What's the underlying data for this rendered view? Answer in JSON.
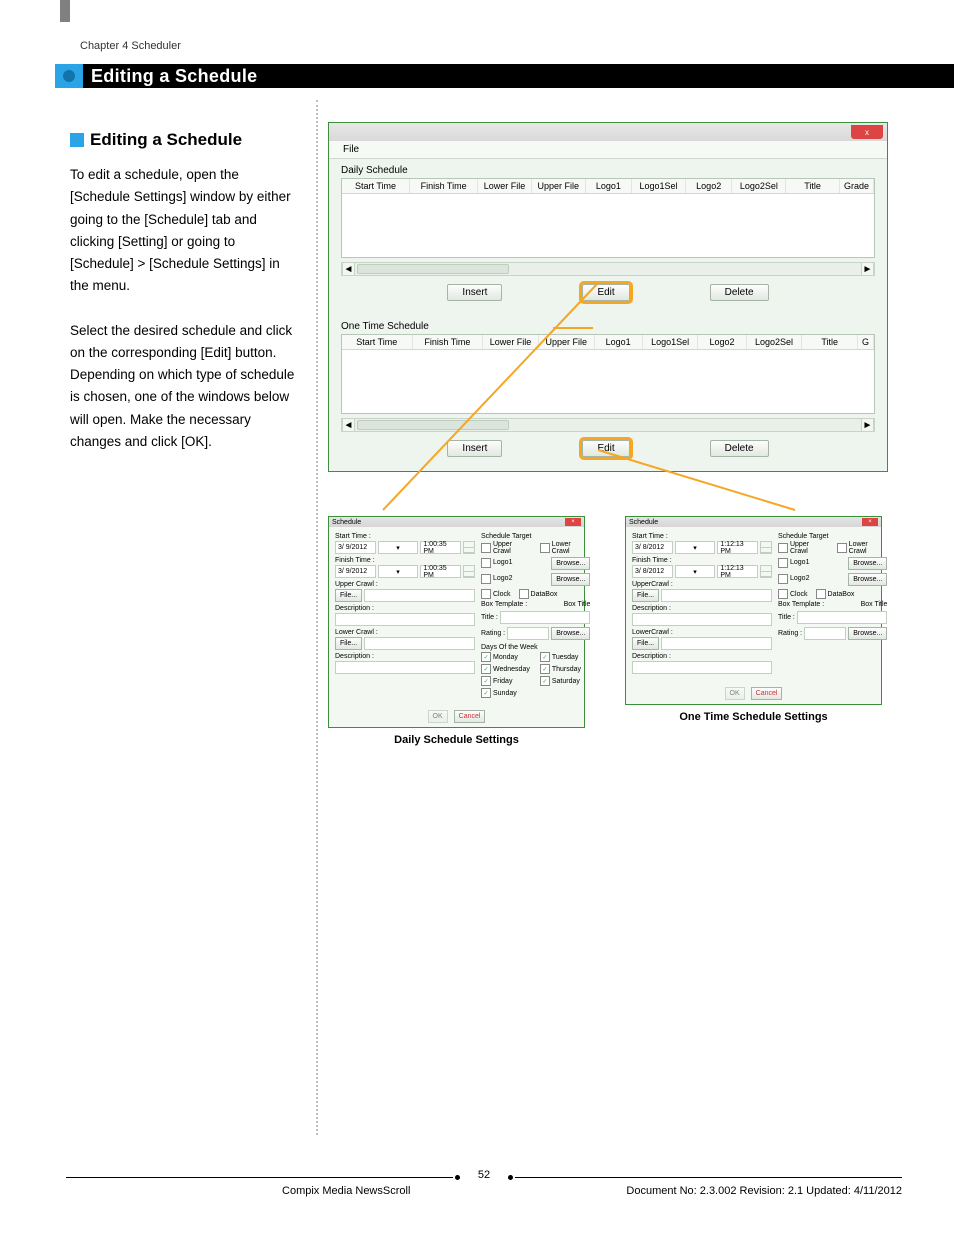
{
  "chapter": "Chapter 4 Scheduler",
  "page_title": "Editing a Schedule",
  "section_heading": "Editing a Schedule",
  "para1": "To edit a schedule, open the [Schedule Settings] window by either going to the [Schedule] tab and clicking [Setting] or going to [Schedule] > [Schedule Settings] in the menu.",
  "para2": "Select the desired schedule and click on the corresponding [Edit] button. Depending on which type of schedule is chosen, one of the windows below will open. Make the necessary changes and click [OK].",
  "win": {
    "close": "x",
    "menu": "File",
    "daily_label": "Daily Schedule",
    "onetime_label": "One Time Schedule",
    "cols_daily": [
      "Start Time",
      "Finish Time",
      "Lower File",
      "Upper File",
      "Logo1",
      "Logo1Sel",
      "Logo2",
      "Logo2Sel",
      "Title",
      "Grade"
    ],
    "cols_onetime": [
      "Start Time",
      "Finish Time",
      "Lower File",
      "Upper File",
      "Logo1",
      "Logo1Sel",
      "Logo2",
      "Logo2Sel",
      "Title",
      "G"
    ],
    "btn_insert": "Insert",
    "btn_edit": "Edit",
    "btn_delete": "Delete"
  },
  "dlg_daily": {
    "title": "Schedule",
    "start_lbl": "Start Time :",
    "finish_lbl": "Finish Time :",
    "date": "3/ 9/2012",
    "time": "1:00:35 PM",
    "upper_lbl": "Upper Crawl :",
    "lower_lbl": "Lower Crawl :",
    "desc_lbl": "Description :",
    "file_btn": "File...",
    "target_lbl": "Schedule Target",
    "chk_upper": "Upper Crawl",
    "chk_lower": "Lower Crawl",
    "chk_logo1": "Logo1",
    "chk_logo2": "Logo2",
    "chk_clock": "Clock",
    "chk_databox": "DataBox",
    "browse": "Browse...",
    "biz_lbl": "Box Template :",
    "boxtitle": "Box Title",
    "title_lbl": "Title :",
    "rating_lbl": "Rating :",
    "days_lbl": "Days Of the Week",
    "mon": "Monday",
    "tue": "Tuesday",
    "wed": "Wednesday",
    "thu": "Thursday",
    "fri": "Friday",
    "sat": "Saturday",
    "sun": "Sunday",
    "ok": "OK",
    "cancel": "Cancel",
    "caption": "Daily Schedule Settings"
  },
  "dlg_one": {
    "title": "Schedule",
    "start_lbl": "Start Time :",
    "finish_lbl": "Finish Time :",
    "date": "3/ 8/2012",
    "time": "1:12:13 PM",
    "upper_lbl": "UpperCrawl :",
    "lower_lbl": "LowerCrawl :",
    "desc_lbl": "Description :",
    "file_btn": "File...",
    "target_lbl": "Schedule Target",
    "chk_upper": "Upper Crawl",
    "chk_lower": "Lower Crawl",
    "chk_logo1": "Logo1",
    "chk_logo2": "Logo2",
    "chk_clock": "Clock",
    "chk_databox": "DataBox",
    "browse": "Browse...",
    "biz_lbl": "Box Template :",
    "boxtitle": "Box Title",
    "title_lbl": "Title :",
    "rating_lbl": "Rating :",
    "ok": "OK",
    "cancel": "Cancel",
    "caption": "One Time Schedule Settings"
  },
  "footer": {
    "page": "52",
    "product": "Compix Media NewsScroll",
    "docinfo": "Document No: 2.3.002 Revision: 2.1 Updated: 4/11/2012"
  }
}
